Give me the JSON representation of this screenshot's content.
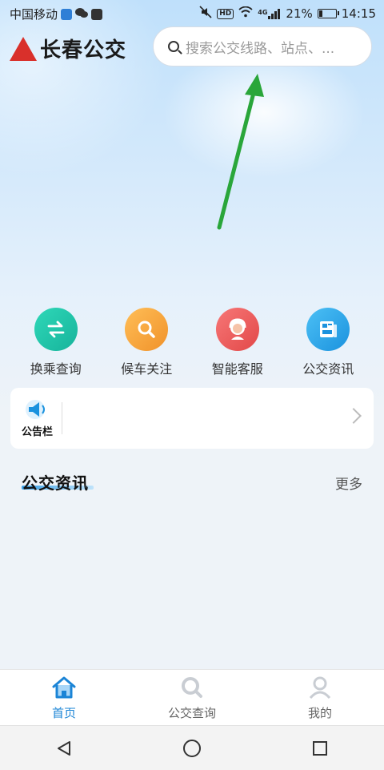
{
  "status_bar": {
    "carrier": "中国移动",
    "network_type": "4G",
    "battery_percent": "21%",
    "battery_level": 0.21,
    "time": "14:15",
    "hd_badge": "HD"
  },
  "header": {
    "app_name": "长春公交",
    "search_placeholder": "搜索公交线路、站点、..."
  },
  "quick_actions": [
    {
      "label": "换乘查询",
      "icon": "transfer-icon",
      "color": "#1fc4a9"
    },
    {
      "label": "候车关注",
      "icon": "magnifier-icon",
      "color": "#f5a03a"
    },
    {
      "label": "智能客服",
      "icon": "customer-service-icon",
      "color": "#ee5a5a"
    },
    {
      "label": "公交资讯",
      "icon": "news-icon",
      "color": "#2ca6ea"
    }
  ],
  "notice": {
    "title": "公告栏",
    "icon": "megaphone-icon"
  },
  "news_section": {
    "title": "公交资讯",
    "more_label": "更多"
  },
  "tab_bar": {
    "active_color": "#1b84d6",
    "items": [
      {
        "label": "首页",
        "icon": "home-icon",
        "active": true
      },
      {
        "label": "公交查询",
        "icon": "search-icon",
        "active": false
      },
      {
        "label": "我的",
        "icon": "user-icon",
        "active": false
      }
    ]
  },
  "nav_bar": {
    "buttons": [
      "back-icon",
      "home-circle-icon",
      "recents-square-icon"
    ]
  }
}
